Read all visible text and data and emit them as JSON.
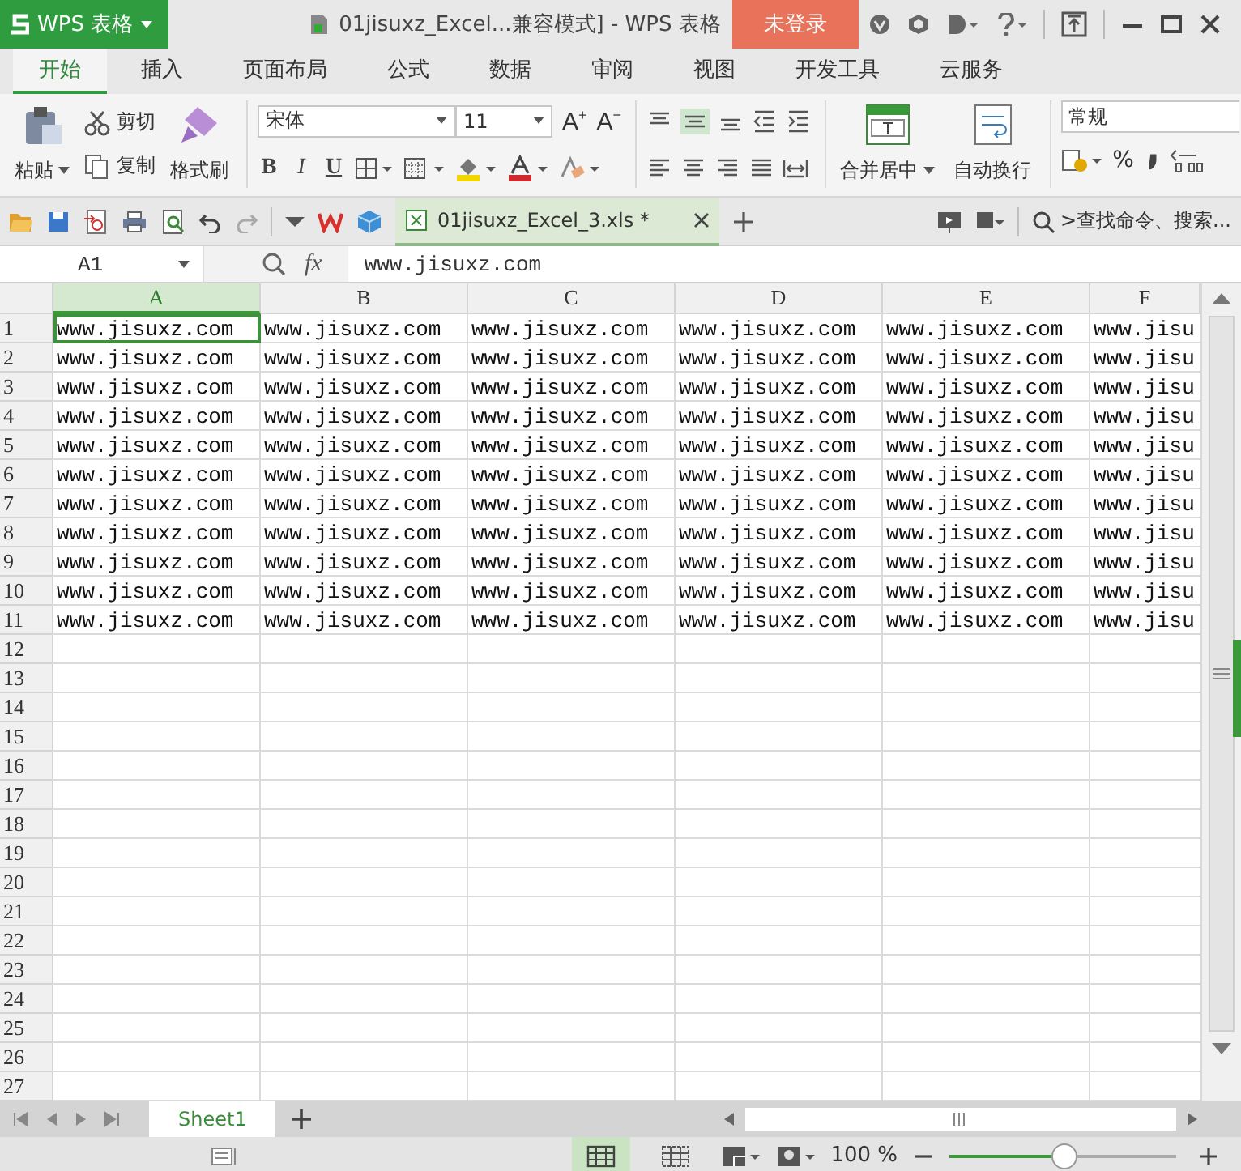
{
  "title_bar": {
    "app_menu": "WPS 表格",
    "document_title": "01jisuxz_Excel...兼容模式] - WPS 表格",
    "login_button": "未登录"
  },
  "ribbon_tabs": [
    {
      "label": "开始",
      "selected": true
    },
    {
      "label": "插入",
      "selected": false
    },
    {
      "label": "页面布局",
      "selected": false
    },
    {
      "label": "公式",
      "selected": false
    },
    {
      "label": "数据",
      "selected": false
    },
    {
      "label": "审阅",
      "selected": false
    },
    {
      "label": "视图",
      "selected": false
    },
    {
      "label": "开发工具",
      "selected": false
    },
    {
      "label": "云服务",
      "selected": false
    }
  ],
  "ribbon": {
    "paste": "粘贴",
    "cut": "剪切",
    "copy": "复制",
    "format_painter": "格式刷",
    "font_name": "宋体",
    "font_size": "11",
    "grow_font": "A$^{+}$",
    "shrink_font": "A$^{−}$",
    "bold": "B",
    "italic": "I",
    "underline": "U",
    "merge_center": "合并居中",
    "wrap_text": "自动换行",
    "number_format": "常规",
    "percent": "%"
  },
  "document_tabs": [
    {
      "label": "01jisuxz_Excel_3.xls *",
      "selected": true
    }
  ],
  "command_search": {
    "placeholder": ">查找命令、搜索..."
  },
  "formula_bar": {
    "cell_reference": "A1",
    "function_label": "fx",
    "value": "www.jisuxz.com"
  },
  "sheet": {
    "columns": [
      {
        "label": "A",
        "selected": true
      },
      {
        "label": "B",
        "selected": false
      },
      {
        "label": "C",
        "selected": false
      },
      {
        "label": "D",
        "selected": false
      },
      {
        "label": "E",
        "selected": false
      },
      {
        "label": "F",
        "selected": false
      }
    ],
    "row_numbers": [
      "1",
      "2",
      "3",
      "4",
      "5",
      "6",
      "7",
      "8",
      "9",
      "10",
      "11",
      "12",
      "13",
      "14",
      "15",
      "16",
      "17",
      "18",
      "19",
      "20",
      "21",
      "22",
      "23",
      "24",
      "25",
      "26",
      "27"
    ],
    "rows": [
      [
        "www.jisuxz.com",
        "www.jisuxz.com",
        "www.jisuxz.com",
        "www.jisuxz.com",
        "www.jisuxz.com",
        "www.jisu"
      ],
      [
        "www.jisuxz.com",
        "www.jisuxz.com",
        "www.jisuxz.com",
        "www.jisuxz.com",
        "www.jisuxz.com",
        "www.jisu"
      ],
      [
        "www.jisuxz.com",
        "www.jisuxz.com",
        "www.jisuxz.com",
        "www.jisuxz.com",
        "www.jisuxz.com",
        "www.jisu"
      ],
      [
        "www.jisuxz.com",
        "www.jisuxz.com",
        "www.jisuxz.com",
        "www.jisuxz.com",
        "www.jisuxz.com",
        "www.jisu"
      ],
      [
        "www.jisuxz.com",
        "www.jisuxz.com",
        "www.jisuxz.com",
        "www.jisuxz.com",
        "www.jisuxz.com",
        "www.jisu"
      ],
      [
        "www.jisuxz.com",
        "www.jisuxz.com",
        "www.jisuxz.com",
        "www.jisuxz.com",
        "www.jisuxz.com",
        "www.jisu"
      ],
      [
        "www.jisuxz.com",
        "www.jisuxz.com",
        "www.jisuxz.com",
        "www.jisuxz.com",
        "www.jisuxz.com",
        "www.jisu"
      ],
      [
        "www.jisuxz.com",
        "www.jisuxz.com",
        "www.jisuxz.com",
        "www.jisuxz.com",
        "www.jisuxz.com",
        "www.jisu"
      ],
      [
        "www.jisuxz.com",
        "www.jisuxz.com",
        "www.jisuxz.com",
        "www.jisuxz.com",
        "www.jisuxz.com",
        "www.jisu"
      ],
      [
        "www.jisuxz.com",
        "www.jisuxz.com",
        "www.jisuxz.com",
        "www.jisuxz.com",
        "www.jisuxz.com",
        "www.jisu"
      ],
      [
        "www.jisuxz.com",
        "www.jisuxz.com",
        "www.jisuxz.com",
        "www.jisuxz.com",
        "www.jisuxz.com",
        "www.jisu"
      ]
    ]
  },
  "sheet_tabs": [
    {
      "label": "Sheet1",
      "selected": true
    }
  ],
  "status_bar": {
    "zoom": "100 %",
    "zoom_slider": {
      "level": 0.5
    }
  }
}
